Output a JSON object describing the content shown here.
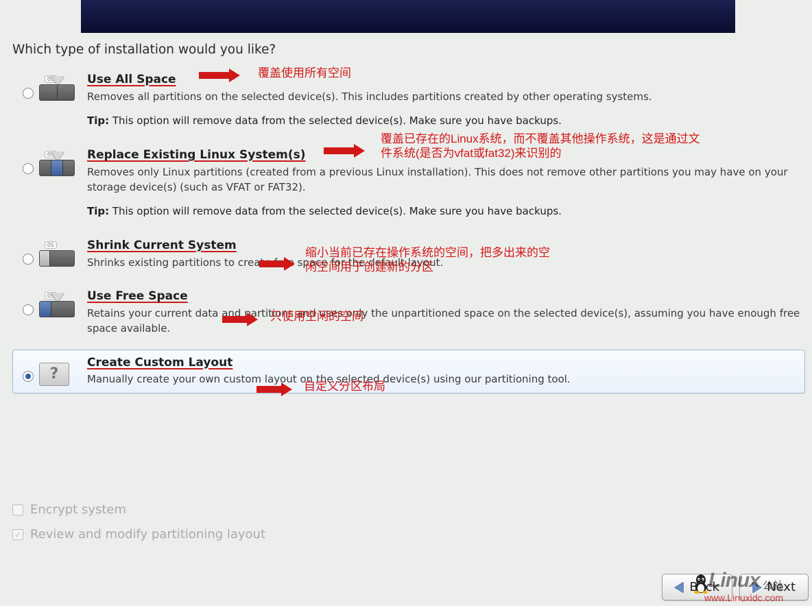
{
  "question": "Which type of installation would you like?",
  "options": [
    {
      "id": "use-all-space",
      "title": "Use All Space",
      "desc": "Removes all partitions on the selected device(s).  This includes partitions created by other operating systems.",
      "tipLabel": "Tip:",
      "tip": "This option will remove data from the selected device(s).  Make sure you have backups.",
      "selected": false,
      "osBadge": "OS",
      "annot": "覆盖使用所有空间"
    },
    {
      "id": "replace-existing",
      "title": "Replace Existing Linux System(s)",
      "desc": "Removes only Linux partitions (created from a previous Linux installation).  This does not remove other partitions you may have on your storage device(s) (such as VFAT or FAT32).",
      "tipLabel": "Tip:",
      "tip": "This option will remove data from the selected device(s).  Make sure you have backups.",
      "selected": false,
      "osBadge": "OS",
      "annot": "覆盖已存在的Linux系统，而不覆盖其他操作系统，这是通过文件系统(是否为vfat或fat32)来识别的"
    },
    {
      "id": "shrink-current",
      "title": "Shrink Current System",
      "desc": "Shrinks existing partitions to create free space for the default layout.",
      "selected": false,
      "osBadge": "OS",
      "annot": "缩小当前已存在操作系统的空间，把多出来的空闲空间用于创建新的分区"
    },
    {
      "id": "use-free-space",
      "title": "Use Free Space",
      "desc": "Retains your current data and partitions and uses only the unpartitioned space on the selected device(s), assuming you have enough free space available.",
      "selected": false,
      "osBadge": "OS",
      "annot": "只使用空闲的空间"
    },
    {
      "id": "create-custom",
      "title": "Create Custom Layout",
      "desc": "Manually create your own custom layout on the selected device(s) using our partitioning tool.",
      "selected": true,
      "qmark": "?",
      "annot": "自定义分区布局"
    }
  ],
  "checks": {
    "encrypt": "Encrypt system",
    "review": "Review and modify partitioning layout",
    "checkmark": "✓"
  },
  "nav": {
    "back": "Back",
    "next": "Next"
  },
  "watermark": {
    "logo": "Linux",
    "cn": "公社",
    "url": "www.Linuxidc.com"
  }
}
